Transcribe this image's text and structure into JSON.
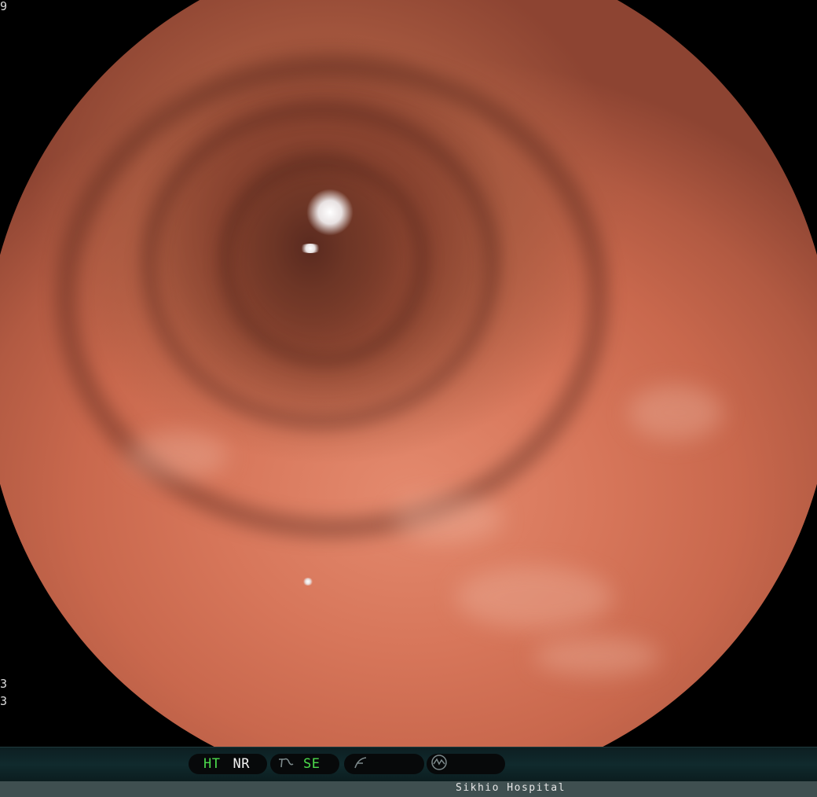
{
  "image": {
    "subject": "endoscopic-view",
    "colors": {
      "mucosa": "#d7765a",
      "lumen": "#5a2a1f",
      "background": "#000000"
    }
  },
  "edge_marks": {
    "top_left": "9",
    "left_lower_1": "3",
    "left_lower_2": "3"
  },
  "status_bar": {
    "indicators": [
      {
        "id": "ht",
        "label": "HT",
        "color": "#4cdb4c"
      },
      {
        "id": "nr",
        "label": "NR",
        "color": "#f2f2f2"
      },
      {
        "id": "se",
        "label": "SE",
        "color": "#4cdb4c"
      }
    ],
    "icons": [
      "structure-enhancement-icon",
      "gamma-curve-icon",
      "waveform-icon"
    ]
  },
  "info_bar": {
    "hospital_name": "Sikhio Hospital"
  }
}
